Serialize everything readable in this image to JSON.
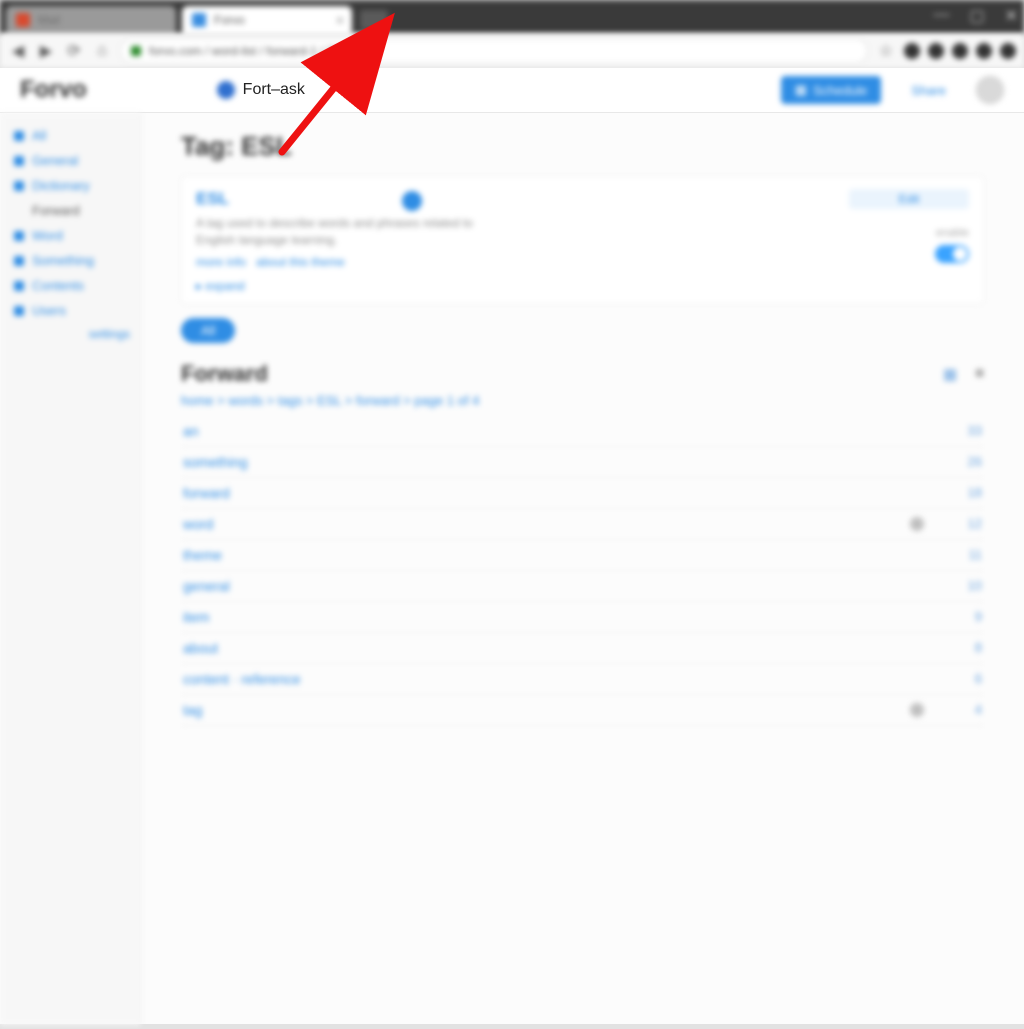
{
  "browser": {
    "tab1": {
      "title": "Mail"
    },
    "tab2": {
      "title": "Forvo"
    },
    "url": "forvo.com / word-list / forward-1 / 20 items",
    "win": {
      "min": "—",
      "max": "▢",
      "close": "✕"
    }
  },
  "header": {
    "logo": "Forvo",
    "lang_label": "Fort–ask",
    "schedule": "Schedule",
    "share": "Share"
  },
  "sidebar": {
    "items": [
      {
        "label": "All"
      },
      {
        "label": "General"
      },
      {
        "label": "Dictionary"
      },
      {
        "label": "Forward",
        "secondary": true
      },
      {
        "label": "Word"
      },
      {
        "label": "Something"
      },
      {
        "label": "Contents"
      },
      {
        "label": "Users"
      }
    ],
    "bottom": "settings"
  },
  "tag": {
    "title": "Tag: ESL",
    "card_title": "ESL",
    "card_desc": "A tag used to describe words and phrases related to English language learning.",
    "card_sub1": "more info",
    "card_sub2": "about this theme",
    "expand": "▸ expand",
    "edit_btn": "Edit",
    "toggle_label": "enable"
  },
  "chip": "All",
  "section": {
    "title": "Forward",
    "crumbs": "home > words > tags > ESL > forward > page 1 of 4"
  },
  "rows": [
    {
      "word": "an",
      "count": "33",
      "flag": false
    },
    {
      "word": "something",
      "count": "26",
      "flag": false
    },
    {
      "word": "forward",
      "count": "18",
      "flag": false
    },
    {
      "word": "word",
      "count": "12",
      "flag": true
    },
    {
      "word": "theme",
      "count": "11",
      "flag": false
    },
    {
      "word": "general",
      "count": "10",
      "flag": false
    },
    {
      "word": "item",
      "count": "9",
      "flag": false
    },
    {
      "word": "about",
      "count": "8",
      "flag": false
    },
    {
      "word": "content · reference",
      "count": "6",
      "flag": false
    },
    {
      "word": "tag",
      "count": "4",
      "flag": true
    }
  ]
}
